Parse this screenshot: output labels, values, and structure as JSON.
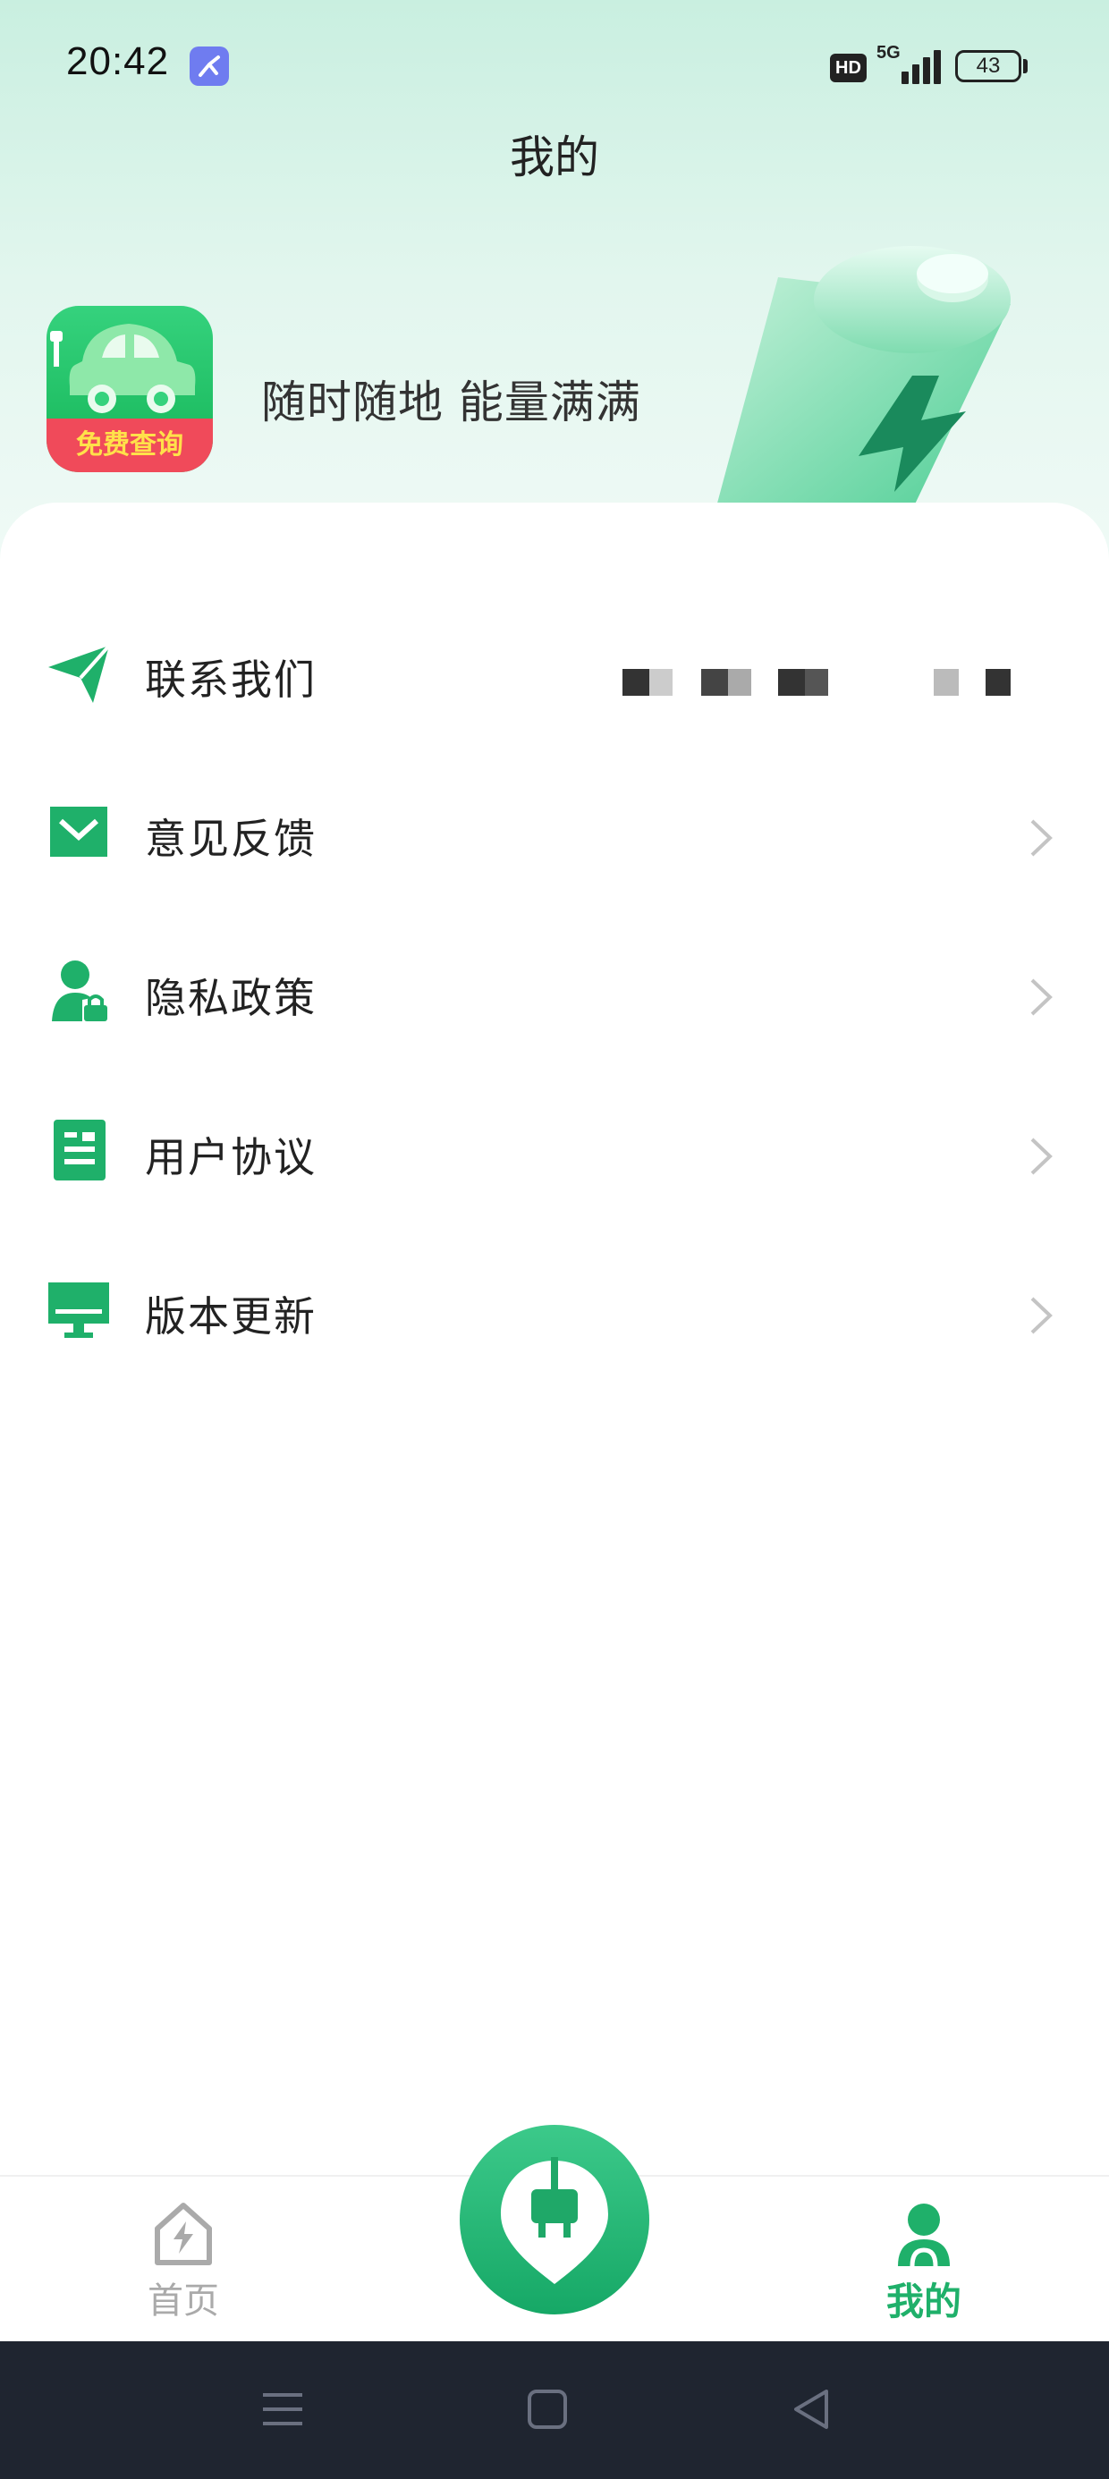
{
  "status_bar": {
    "time": "20:42",
    "hd_badge": "HD",
    "network": "5G",
    "battery_level": "43"
  },
  "header": {
    "title": "我的"
  },
  "banner": {
    "logo_badge_text": "免费查询",
    "slogan": "随时随地 能量满满"
  },
  "menu": {
    "items": [
      {
        "label": "联系我们",
        "icon": "send-icon"
      },
      {
        "label": "意见反馈",
        "icon": "mail-icon"
      },
      {
        "label": "隐私政策",
        "icon": "user-lock-icon"
      },
      {
        "label": "用户协议",
        "icon": "document-icon"
      },
      {
        "label": "版本更新",
        "icon": "monitor-icon"
      }
    ]
  },
  "bottom_nav": {
    "home_label": "首页",
    "mine_label": "我的"
  },
  "colors": {
    "accent": "#1fb06a",
    "header_bg": "#c9efe0",
    "system_nav_bg": "#1f2530"
  }
}
